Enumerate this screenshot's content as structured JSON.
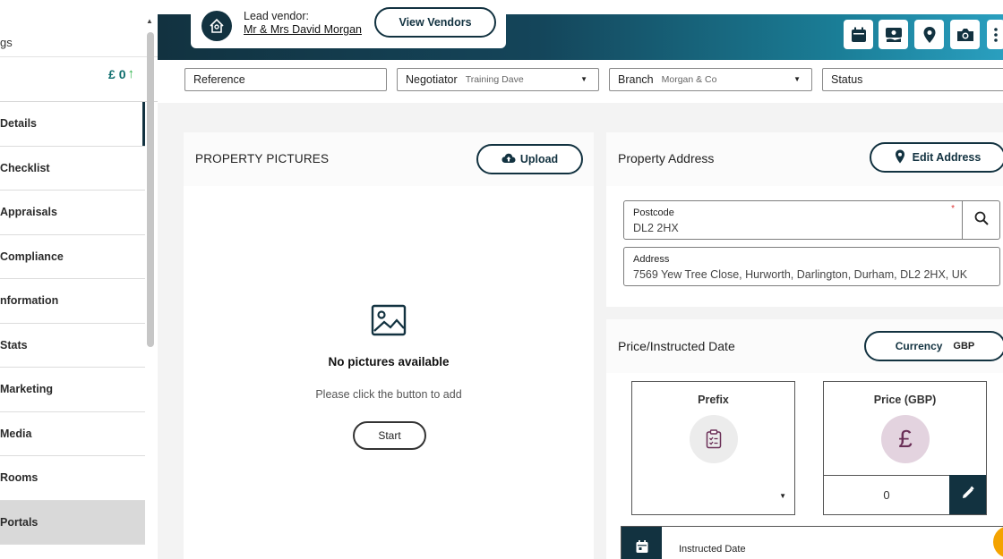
{
  "sidebar": {
    "top_label": "gs",
    "money": "£ 0",
    "items": [
      {
        "label": "Details"
      },
      {
        "label": "Checklist"
      },
      {
        "label": "Appraisals"
      },
      {
        "label": "Compliance"
      },
      {
        "label": "nformation"
      },
      {
        "label": "Stats"
      },
      {
        "label": "Marketing"
      },
      {
        "label": "Media"
      },
      {
        "label": "Rooms"
      },
      {
        "label": "Portals"
      }
    ]
  },
  "header": {
    "vendor_label": "Lead vendor:",
    "vendor_name": "Mr & Mrs David Morgan",
    "view_vendors": "View Vendors",
    "icons": [
      "calendar-icon",
      "money-icon",
      "location-pin-icon",
      "camera-icon",
      "more-icon"
    ]
  },
  "filters": {
    "reference": "Reference",
    "negotiator_label": "Negotiator",
    "negotiator_value": "Training Dave",
    "branch_label": "Branch",
    "branch_value": "Morgan & Co",
    "status": "Status"
  },
  "pictures": {
    "title": "PROPERTY PICTURES",
    "upload": "Upload",
    "empty_title": "No pictures available",
    "empty_sub": "Please click the button to add",
    "start": "Start"
  },
  "address": {
    "title": "Property Address",
    "edit": "Edit Address",
    "postcode_label": "Postcode",
    "postcode_required": "*",
    "postcode_value": "DL2 2HX",
    "address_label": "Address",
    "address_value": "7569 Yew Tree Close, Hurworth, Darlington, Durham, DL2 2HX, UK"
  },
  "price": {
    "title": "Price/Instructed Date",
    "currency_label": "Currency",
    "currency_value": "GBP",
    "prefix_label": "Prefix",
    "price_label": "Price (GBP)",
    "pound_symbol": "£",
    "price_value": "0",
    "instructed_label": "Instructed Date"
  },
  "colors": {
    "brand": "#123240",
    "accent_gradient_end": "#2a9fbf",
    "up_arrow": "#2fb34a",
    "pound_circle": "#e3d3df",
    "prefix_circle": "#ececec",
    "notification": "#f4a300"
  }
}
